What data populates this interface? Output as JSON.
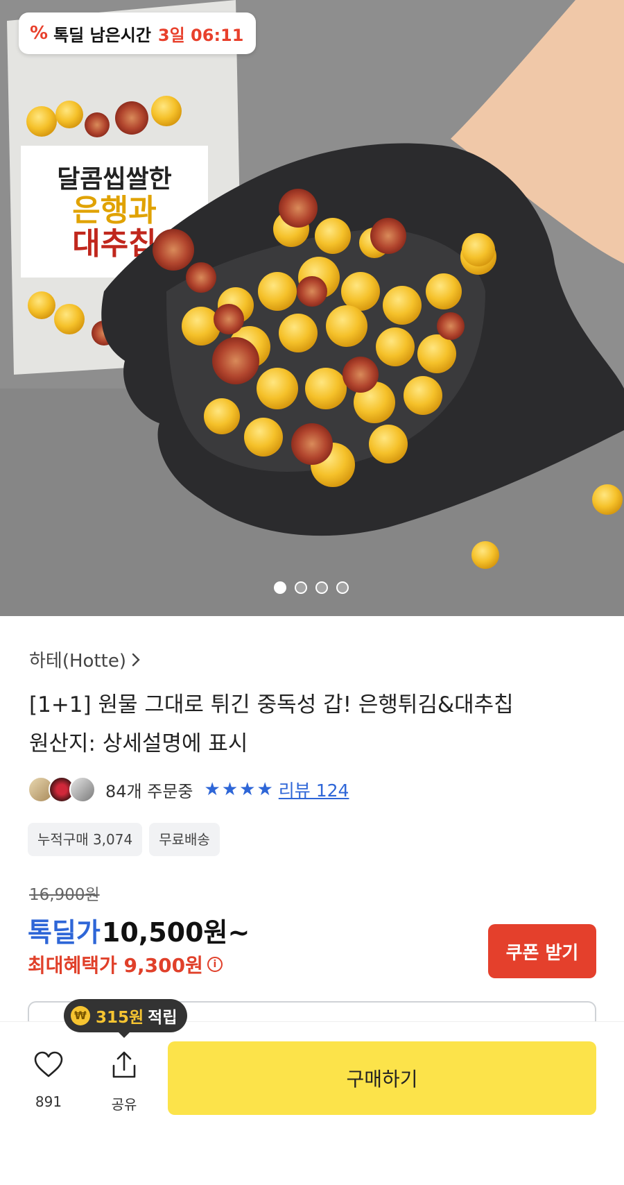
{
  "hero": {
    "timer_label": "톡딜 남은시간",
    "timer_value": "3일 06:11",
    "timer_icon": "percent-icon",
    "carousel_pages": 4,
    "carousel_active": 1
  },
  "product": {
    "seller": "하테(Hotte)",
    "title_line1": "[1+1] 원물 그대로 튀긴 중독성 갑! 은행튀김&대추칩",
    "title_line2": "원산지: 상세설명에 표시",
    "order_count": "84개 주문중",
    "rating_stars": 4,
    "review_link": "리뷰 124",
    "chips": [
      "누적구매 3,074",
      "무료배송"
    ]
  },
  "price": {
    "original": "16,900원",
    "deal_label": "톡딜가",
    "deal_price": "10,500원~",
    "max_benefit": "최대혜택가 9,300원",
    "coupon_button": "쿠폰 받기"
  },
  "bottom": {
    "points_amount": "315원",
    "points_label": "적립",
    "like_count": "891",
    "share_label": "공유",
    "buy_button": "구매하기"
  },
  "colors": {
    "accent_blue": "#2e66d7",
    "accent_red": "#e4402c",
    "buy_yellow": "#fce34a"
  }
}
